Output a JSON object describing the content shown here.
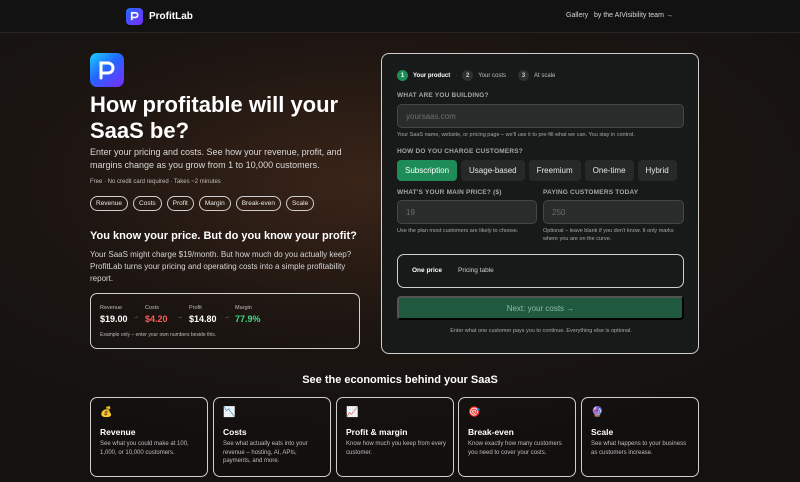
{
  "header": {
    "brand": "ProfitLab",
    "nav": {
      "gallery": "Gallery",
      "team": "by the AIVisibility team →"
    }
  },
  "hero": {
    "title": "How profitable will your SaaS be?",
    "subtitle": "Enter your pricing and costs. See how your revenue, profit, and margins change as you grow from 1 to 10,000 customers.",
    "note": "Free · No credit card required · Takes ~2 minutes",
    "chips": [
      "Revenue",
      "Costs",
      "Profit",
      "Margin",
      "Break-even",
      "Scale"
    ]
  },
  "pitch": {
    "heading": "You know your price. But do you know your profit?",
    "text": "Your SaaS might charge $19/month. But how much do you actually keep? ProfitLab turns your pricing and operating costs into a simple profitability report."
  },
  "example": {
    "items": [
      {
        "label": "Revenue",
        "value": "$19.00",
        "color": "#ffffff"
      },
      {
        "label": "Costs",
        "value": "$4.20",
        "color": "#ff5a5a"
      },
      {
        "label": "Profit",
        "value": "$14.80",
        "color": "#ffffff"
      },
      {
        "label": "Margin",
        "value": "77.9%",
        "color": "#3ddc84"
      }
    ],
    "arrows": [
      "→",
      "→",
      "→"
    ],
    "note": "Example only – enter your own numbers beside this."
  },
  "form": {
    "steps": [
      {
        "num": "1",
        "label": "Your product",
        "active": true
      },
      {
        "num": "2",
        "label": "Your costs",
        "active": false
      },
      {
        "num": "3",
        "label": "At scale",
        "active": false
      }
    ],
    "step_separator": "·",
    "building_label": "WHAT ARE YOU BUILDING?",
    "building_placeholder": "yoursaas.com",
    "building_hint": "Your SaaS name, website, or pricing page – we'll use it to pre-fill what we can. You stay in control.",
    "charge_label": "HOW DO YOU CHARGE CUSTOMERS?",
    "charge_options": [
      "Subscription",
      "Usage-based",
      "Freemium",
      "One-time",
      "Hybrid"
    ],
    "price_label": "WHAT'S YOUR MAIN PRICE? ($)",
    "price_placeholder": "19",
    "price_hint": "Use the plan most customers are likely to choose.",
    "customers_label": "PAYING CUSTOMERS TODAY",
    "customers_placeholder": "250",
    "customers_hint": "Optional – leave blank if you don't know. It only marks where you are on the curve.",
    "tabs": [
      "One price",
      "Pricing table"
    ],
    "next_button": "Next: your costs →",
    "footer": "Enter what one customer pays you to continue. Everything else is optional."
  },
  "economics": {
    "title": "See the economics behind your SaaS",
    "cards": [
      {
        "icon": "💰",
        "title": "Revenue",
        "desc": "See what you could make at 100, 1,000, or 10,000 customers."
      },
      {
        "icon": "📉",
        "title": "Costs",
        "desc": "See what actually eats into your revenue – hosting, AI, APIs, payments, and more."
      },
      {
        "icon": "📈",
        "title": "Profit & margin",
        "desc": "Know how much you keep from every customer."
      },
      {
        "icon": "🎯",
        "title": "Break-even",
        "desc": "Know exactly how many customers you need to cover your costs."
      },
      {
        "icon": "🔮",
        "title": "Scale",
        "desc": "See what happens to your business as customers increase."
      }
    ]
  },
  "colors": {
    "accent": "#1e8c57",
    "cost_red": "#ff5a5a",
    "margin_green": "#3ddc84"
  }
}
